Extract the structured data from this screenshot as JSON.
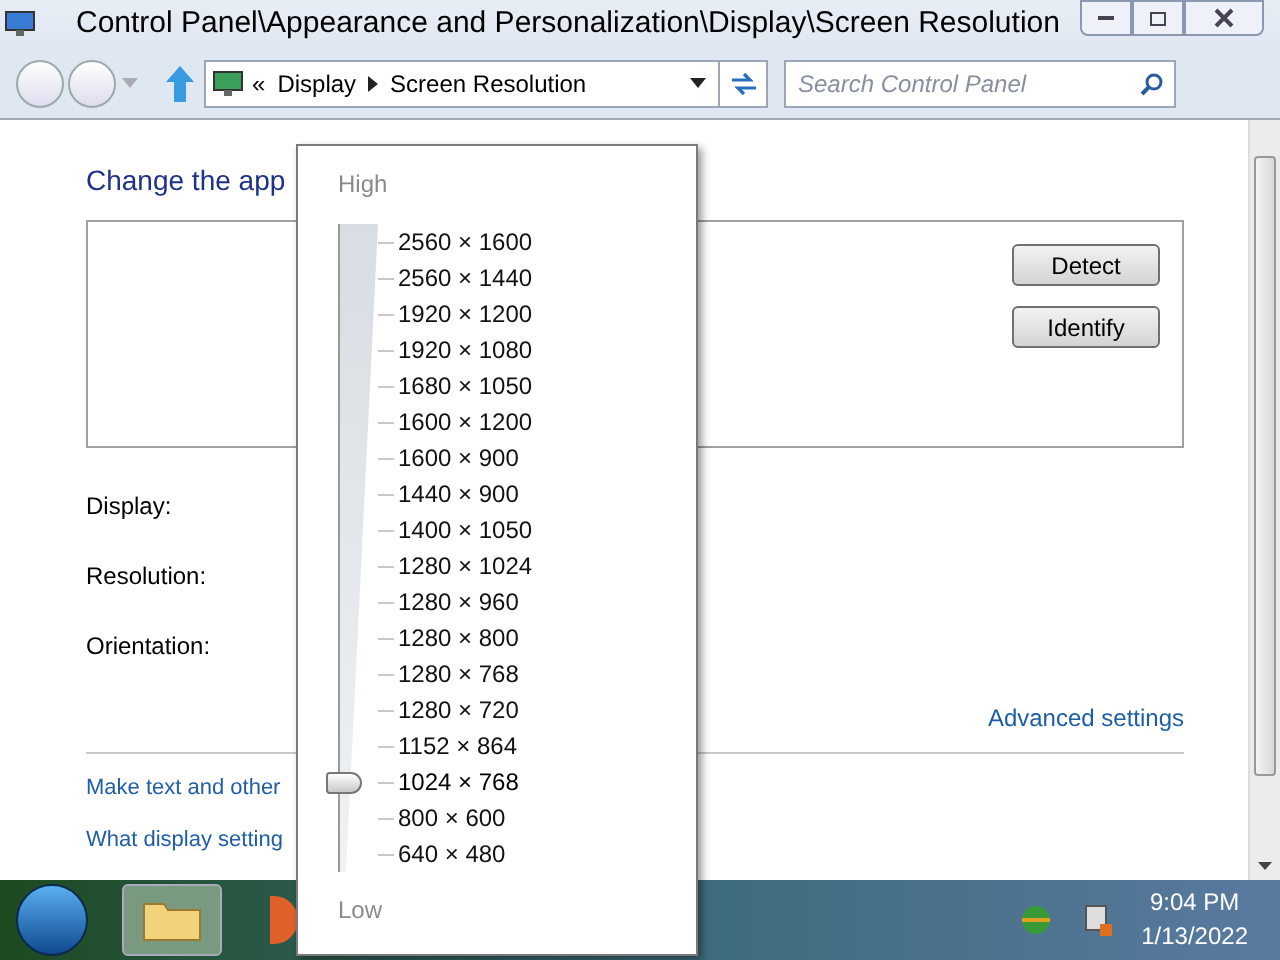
{
  "window": {
    "title": "Control Panel\\Appearance and Personalization\\Display\\Screen Resolution"
  },
  "address_bar": {
    "overflow": "«",
    "crumbs": [
      "Display",
      "Screen Resolution"
    ]
  },
  "search": {
    "placeholder": "Search Control Panel"
  },
  "content": {
    "heading": "Change the app",
    "buttons": [
      "Detect",
      "Identify"
    ],
    "labels": [
      "Display:",
      "Resolution:",
      "Orientation:"
    ],
    "advanced_link": "Advanced settings",
    "links": [
      "Make text and other",
      "What display setting"
    ]
  },
  "resolution_popup": {
    "high_label": "High",
    "low_label": "Low",
    "options": [
      {
        "label": "2560 × 1600",
        "selected": false
      },
      {
        "label": "2560 × 1440",
        "selected": false
      },
      {
        "label": "1920 × 1200",
        "selected": false
      },
      {
        "label": "1920 × 1080",
        "selected": false
      },
      {
        "label": "1680 × 1050",
        "selected": false
      },
      {
        "label": "1600 × 1200",
        "selected": false
      },
      {
        "label": "1600 × 900",
        "selected": false
      },
      {
        "label": "1440 × 900",
        "selected": false
      },
      {
        "label": "1400 × 1050",
        "selected": false
      },
      {
        "label": "1280 × 1024",
        "selected": false
      },
      {
        "label": "1280 × 960",
        "selected": false
      },
      {
        "label": "1280 × 800",
        "selected": false
      },
      {
        "label": "1280 × 768",
        "selected": false
      },
      {
        "label": "1280 × 720",
        "selected": false
      },
      {
        "label": "1152 × 864",
        "selected": false
      },
      {
        "label": "1024 × 768",
        "selected": true
      },
      {
        "label": "800 × 600",
        "selected": false
      },
      {
        "label": "640 × 480",
        "selected": false
      }
    ]
  },
  "taskbar": {
    "time": "9:04 PM",
    "date": "1/13/2022"
  }
}
